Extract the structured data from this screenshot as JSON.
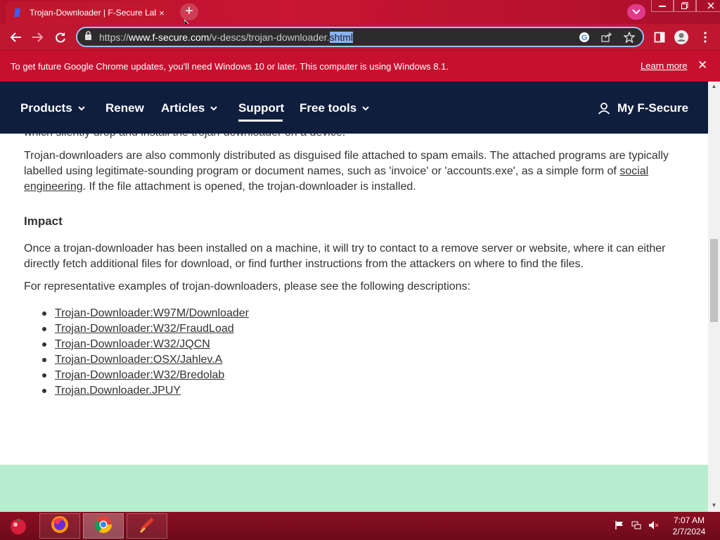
{
  "browser": {
    "tab_title": "Trojan-Downloader | F-Secure Labs",
    "tab_close_glyph": "×",
    "new_tab_glyph": "+",
    "url_prefix": "https://",
    "url_host": "www.f-secure.com",
    "url_path": "/v-descs/trojan-downloader.",
    "url_selected": "shtml",
    "window_controls": [
      "minimize",
      "restore",
      "close"
    ]
  },
  "infobar": {
    "message": "To get future Google Chrome updates, you'll need Windows 10 or later. This computer is using Windows 8.1.",
    "learn_more": "Learn more",
    "close_glyph": "✕"
  },
  "sitenav": {
    "items": [
      {
        "label": "Products",
        "has_caret": true
      },
      {
        "label": "Renew",
        "has_caret": false
      },
      {
        "label": "Articles",
        "has_caret": true
      },
      {
        "label": "Support",
        "has_caret": false,
        "active": true
      },
      {
        "label": "Free tools",
        "has_caret": true
      }
    ],
    "account_label": "My F-Secure"
  },
  "content": {
    "cut_line": "which silently drop and install the trojan-downloader on a device.",
    "para1_before": "Trojan-downloaders are also commonly distributed as disguised file attached to spam emails. The attached programs are typically labelled using legitimate-sounding program or document names, such as 'invoice' or 'accounts.exe', as a simple form of ",
    "para1_link": "social engineering",
    "para1_after": ". If the file attachment is opened, the trojan-downloader is installed.",
    "impact_heading": "Impact",
    "para2": "Once a trojan-downloader has been installed on a machine, it will try to contact to a remove server or website, where it can either directly fetch additional files for download, or find further instructions from the attackers on where to find the files.",
    "para3": "For representative examples of trojan-downloaders, please see the following descriptions:",
    "links": [
      "Trojan-Downloader:W97M/Downloader",
      "Trojan-Downloader:W32/FraudLoad",
      "Trojan-Downloader:W32/JQCN",
      "Trojan-Downloader:OSX/Jahlev.A",
      "Trojan-Downloader:W32/Bredolab",
      "Trojan.Downloader.JPUY"
    ]
  },
  "taskbar": {
    "apps": [
      "firefox-icon",
      "chrome-icon",
      "ccleaner-icon"
    ],
    "time": "7:07 AM",
    "date": "2/7/2024"
  },
  "colors": {
    "chrome_red": "#c0172f",
    "site_navy": "#0f1e3d",
    "footer_mint": "#b6eecf",
    "taskbar": "#7a0c1e"
  }
}
